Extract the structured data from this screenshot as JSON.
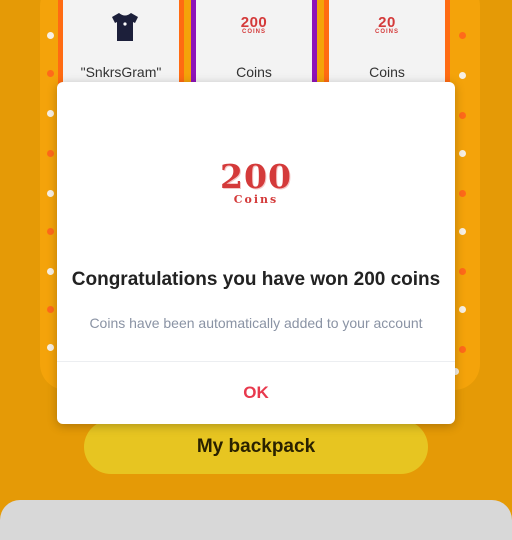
{
  "prizes": [
    {
      "label": "\"SnkrsGram\"",
      "icon": "tshirt-icon"
    },
    {
      "label": "Coins",
      "amount": "200",
      "unit": "COINS"
    },
    {
      "label": "Coins",
      "amount": "20",
      "unit": "COINS"
    }
  ],
  "backpack": {
    "label": "My backpack"
  },
  "modal": {
    "coins_amount": "200",
    "coins_unit": "Coins",
    "title": "Congratulations you have won 200 coins",
    "message": "Coins have been automatically added to your account",
    "ok_label": "OK"
  },
  "colors": {
    "background": "#e59a06",
    "accent_red": "#e8394d",
    "coin_red": "#d43a3a",
    "backpack_yellow": "#e7c521"
  }
}
